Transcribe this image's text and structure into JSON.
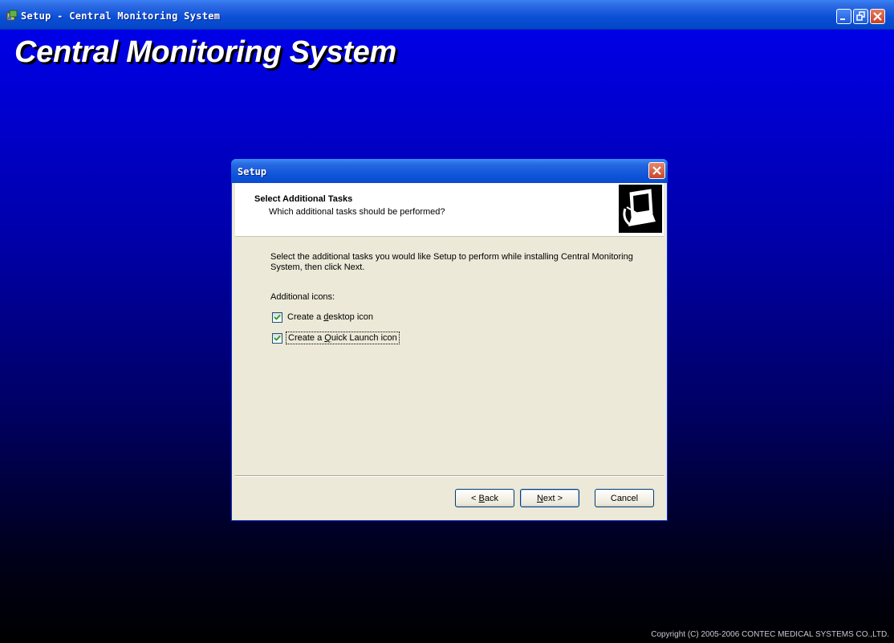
{
  "window": {
    "title": "Setup - Central Monitoring System"
  },
  "banner": {
    "title": "Central Monitoring System",
    "copyright": "Copyright (C) 2005-2006 CONTEC MEDICAL SYSTEMS CO.,LTD."
  },
  "dialog": {
    "title": "Setup",
    "header": {
      "title": "Select Additional Tasks",
      "subtitle": "Which additional tasks should be performed?"
    },
    "description": "Select the additional tasks you would like Setup to perform while installing Central Monitoring System, then click Next.",
    "additional_icons_label": "Additional icons:",
    "tasks": [
      {
        "label_before": "Create a ",
        "accel": "d",
        "label_after": "esktop icon",
        "checked": true
      },
      {
        "label_before": "Create a ",
        "accel": "Q",
        "label_after": "uick Launch icon",
        "checked": true
      }
    ],
    "buttons": {
      "back": {
        "prefix": "< ",
        "accel": "B",
        "rest": "ack"
      },
      "next": {
        "accel": "N",
        "rest": "ext >"
      },
      "cancel": "Cancel"
    }
  },
  "colors": {
    "background_top": "#0000ee",
    "background_bottom": "#000000",
    "titlebar": "#0a4fd6",
    "dialog_face": "#ece9d8"
  },
  "icons": [
    "setup-app-icon",
    "minimize-icon",
    "restore-icon",
    "close-icon",
    "dialog-close-icon",
    "computer-install-icon",
    "checkmark-icon"
  ]
}
